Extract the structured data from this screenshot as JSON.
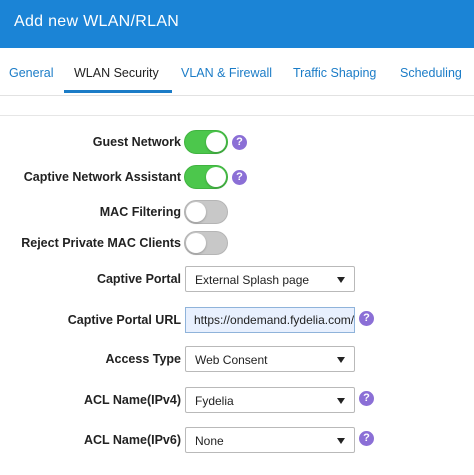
{
  "header": {
    "title": "Add new WLAN/RLAN"
  },
  "tabs": [
    {
      "label": "General"
    },
    {
      "label": "WLAN Security"
    },
    {
      "label": "VLAN & Firewall"
    },
    {
      "label": "Traffic Shaping"
    },
    {
      "label": "Scheduling"
    }
  ],
  "active_tab": "WLAN Security",
  "form": {
    "guest_network": {
      "label": "Guest Network",
      "enabled": true
    },
    "captive_network_assistant": {
      "label": "Captive Network Assistant",
      "enabled": true
    },
    "mac_filtering": {
      "label": "MAC Filtering",
      "enabled": false
    },
    "reject_private_mac": {
      "label": "Reject Private MAC Clients",
      "enabled": false
    },
    "captive_portal": {
      "label": "Captive Portal",
      "value": "External Splash page"
    },
    "captive_portal_url": {
      "label": "Captive Portal URL",
      "value": "https://ondemand.fydelia.com/splash"
    },
    "access_type": {
      "label": "Access Type",
      "value": "Web Consent"
    },
    "acl_ipv4": {
      "label": "ACL Name(IPv4)",
      "value": "Fydelia"
    },
    "acl_ipv6": {
      "label": "ACL Name(IPv6)",
      "value": "None"
    }
  },
  "icons": {
    "help": "?"
  },
  "colors": {
    "header_bg": "#1b84d6",
    "tab_accent": "#1b7cc7",
    "toggle_on": "#4cc74c",
    "toggle_off": "#c8c8c8",
    "help_icon": "#8b6fd6"
  }
}
